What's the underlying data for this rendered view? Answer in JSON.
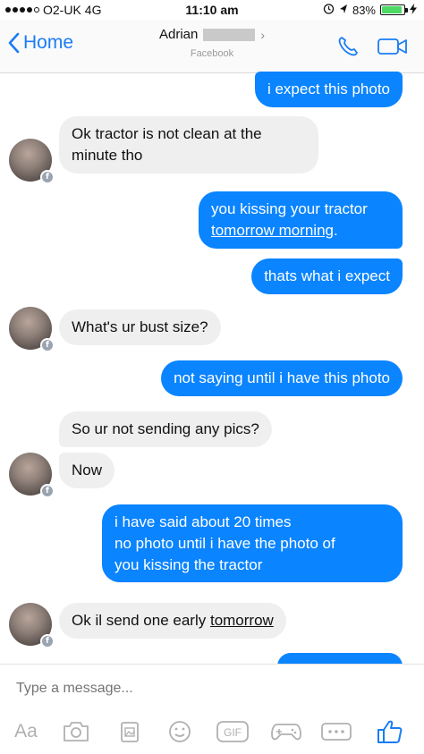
{
  "status": {
    "carrier": "O2-UK",
    "network": "4G",
    "time": "11:10 am",
    "battery": "83%",
    "battery_level": 0.83
  },
  "header": {
    "back_label": "Home",
    "contact_name": "Adrian",
    "contact_source": "Facebook"
  },
  "messages": [
    {
      "from": "me",
      "text": "i expect this photo"
    },
    {
      "from": "them",
      "text": "Ok tractor is not clean at the minute tho"
    },
    {
      "from": "me",
      "text_a": "you kissing your tractor",
      "text_b": "tomorrow morning",
      "text_c": "."
    },
    {
      "from": "me",
      "text": "thats what i expect"
    },
    {
      "from": "them",
      "text": "What's ur bust size?"
    },
    {
      "from": "me",
      "text": "not saying until i have this photo"
    },
    {
      "from": "them",
      "text": "So ur not sending any pics?"
    },
    {
      "from": "them",
      "text": "Now"
    },
    {
      "from": "me",
      "line1": "i have said about 20 times",
      "line2": "no photo until i have the photo of",
      "line3": "you kissing the tractor"
    },
    {
      "from": "them",
      "text_a": "Ok il send one early ",
      "text_b": "tomorrow"
    }
  ],
  "composer": {
    "placeholder": "Type a message...",
    "aa_label": "Aa",
    "gif_label": "GIF"
  },
  "icons": {
    "back": "chevron-left-icon",
    "call": "phone-icon",
    "video": "video-camera-icon",
    "camera": "camera-icon",
    "gallery": "photo-gallery-icon",
    "emoji": "emoji-icon",
    "gif": "gif-icon",
    "game": "game-controller-icon",
    "more": "more-icon",
    "like": "thumbs-up-icon"
  },
  "colors": {
    "accent": "#1a7cf5",
    "outgoing_bubble": "#0a84ff",
    "incoming_bubble": "#efefef"
  }
}
